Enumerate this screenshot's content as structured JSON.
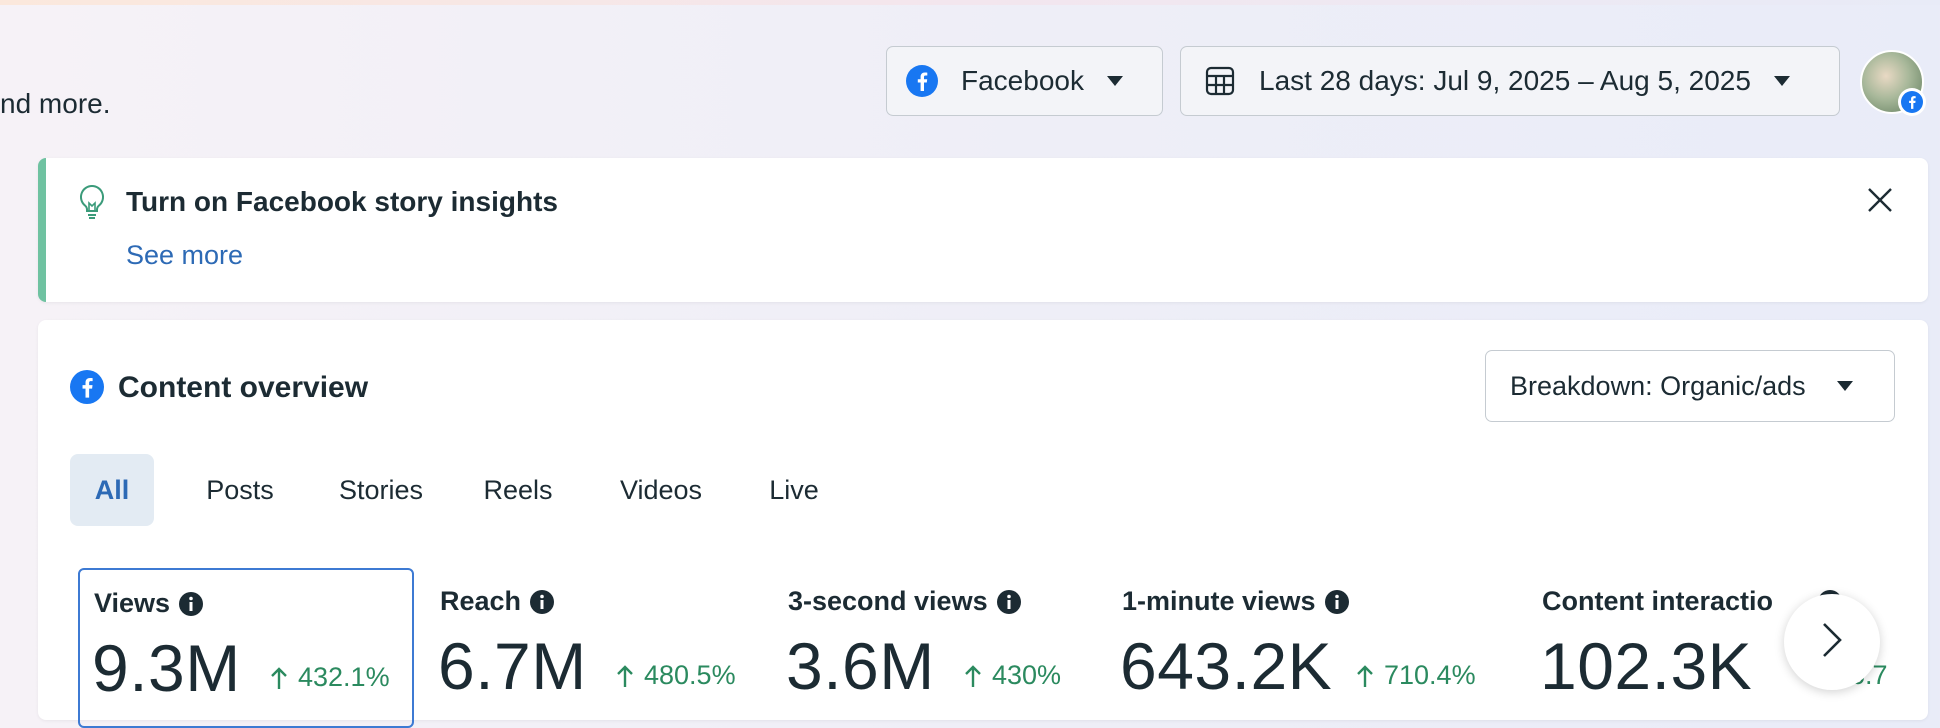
{
  "header": {
    "subtitle_fragment": "nd more.",
    "platform_dropdown": {
      "label": "Facebook",
      "icon": "facebook-icon"
    },
    "date_dropdown": {
      "label": "Last 28 days: Jul 9, 2025 – Aug 5, 2025",
      "icon": "calendar-icon"
    },
    "avatar": {
      "badge": "facebook-icon"
    }
  },
  "banner": {
    "title": "Turn on Facebook story insights",
    "link": "See more",
    "accent_color": "#6fc2a1"
  },
  "content_overview": {
    "title": "Content overview",
    "breakdown_label": "Breakdown: Organic/ads",
    "tabs": [
      {
        "label": "All",
        "active": true
      },
      {
        "label": "Posts",
        "active": false
      },
      {
        "label": "Stories",
        "active": false
      },
      {
        "label": "Reels",
        "active": false
      },
      {
        "label": "Videos",
        "active": false
      },
      {
        "label": "Live",
        "active": false
      }
    ],
    "metrics": [
      {
        "label": "Views",
        "value": "9.3M",
        "delta": "432.1%",
        "selected": true
      },
      {
        "label": "Reach",
        "value": "6.7M",
        "delta": "480.5%",
        "selected": false
      },
      {
        "label": "3-second views",
        "value": "3.6M",
        "delta": "430%",
        "selected": false
      },
      {
        "label": "1-minute views",
        "value": "643.2K",
        "delta": "710.4%",
        "selected": false
      },
      {
        "label": "Content interactio",
        "value": "102.3K",
        "delta": "6.7",
        "selected": false
      }
    ]
  },
  "colors": {
    "brand_blue": "#1877f2",
    "link_blue": "#2d6ab5",
    "positive_green": "#2b8a5f",
    "selected_border": "#3d7ad3"
  }
}
